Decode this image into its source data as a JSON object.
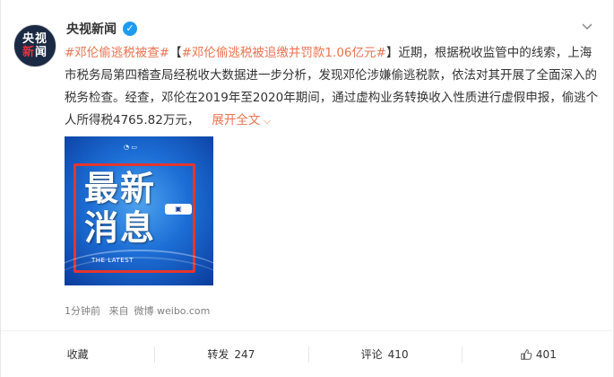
{
  "post": {
    "author": "央视新闻",
    "avatar_text_line1": "央视",
    "avatar_text_line2a": "新",
    "avatar_text_line2b": "闻",
    "hashtag1": "#邓伦偷逃税被查#",
    "bracket_open": "【",
    "hashtag2": "#邓伦偷逃税被追缴并罚款1.06亿元#",
    "bracket_close": "】",
    "body": "近期，根据税收监管中的线索，上海市税务局第四稽查局经税收大数据进一步分析，发现邓伦涉嫌偷逃税款，依法对其开展了全面深入的税务检查。经查，邓伦在2019年至2020年期间，通过虚构业务转换收入性质进行虚假申报，偷逃个人所得税4765.82万元，",
    "expand_label": "展开全文",
    "image": {
      "headline_line1": "最新",
      "headline_line2": "消息",
      "subtitle": "THE LATEST"
    },
    "time": "1分钟前",
    "source_prefix": "来自",
    "source": "微博 weibo.com"
  },
  "actions": {
    "favorite_label": "收藏",
    "repost_label": "转发",
    "repost_count": "247",
    "comment_label": "评论",
    "comment_count": "410",
    "like_count": "401"
  },
  "colors": {
    "link": "#eb7350",
    "verified": "#1d9bf0"
  }
}
